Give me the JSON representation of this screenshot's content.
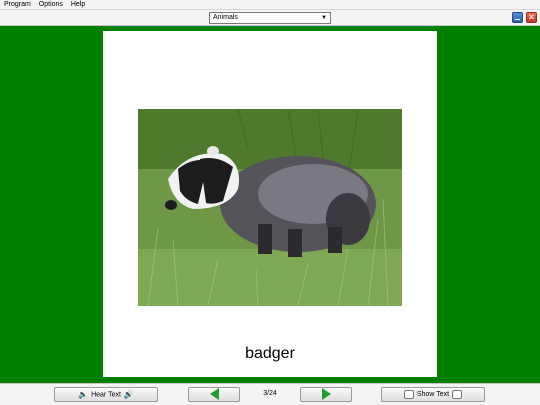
{
  "menu": {
    "items": [
      "Program",
      "Options",
      "Help"
    ]
  },
  "toolbar": {
    "category_value": "Animals"
  },
  "card": {
    "word": "badger"
  },
  "bottom": {
    "hear_label": "Hear Text",
    "show_label": "Show Text",
    "counter": "3/24"
  },
  "colors": {
    "background": "#008000",
    "arrow": "#1f9e2d"
  },
  "icons": [
    "minimize-icon",
    "close-icon",
    "speaker-icon",
    "arrow-left-icon",
    "arrow-right-icon",
    "toggle-icon",
    "chevron-down-icon"
  ]
}
